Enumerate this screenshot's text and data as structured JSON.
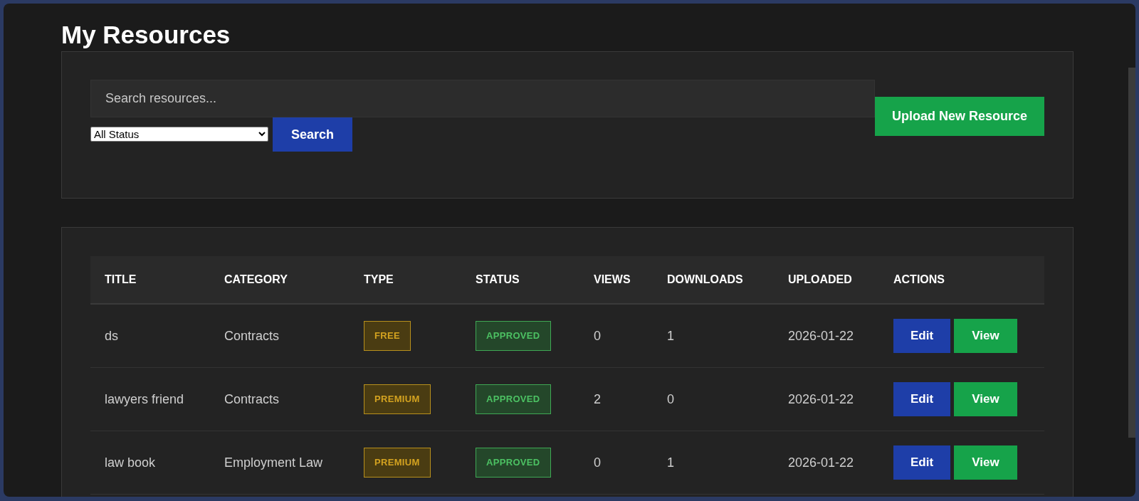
{
  "page": {
    "title": "My Resources"
  },
  "search": {
    "placeholder": "Search resources...",
    "status_filter": "All Status",
    "search_button": "Search",
    "upload_button": "Upload New Resource"
  },
  "table": {
    "columns": [
      "TITLE",
      "CATEGORY",
      "TYPE",
      "STATUS",
      "VIEWS",
      "DOWNLOADS",
      "UPLOADED",
      "ACTIONS"
    ],
    "rows": [
      {
        "title": "ds",
        "category": "Contracts",
        "type": "FREE",
        "status": {
          "label": "APPROVED",
          "kind": "approved"
        },
        "views": "0",
        "downloads": "1",
        "uploaded": "2026-01-22",
        "actions": [
          "Edit",
          "View"
        ]
      },
      {
        "title": "lawyers friend",
        "category": "Contracts",
        "type": "PREMIUM",
        "status": {
          "label": "APPROVED",
          "kind": "approved"
        },
        "views": "2",
        "downloads": "0",
        "uploaded": "2026-01-22",
        "actions": [
          "Edit",
          "View"
        ]
      },
      {
        "title": "law book",
        "category": "Employment Law",
        "type": "PREMIUM",
        "status": {
          "label": "APPROVED",
          "kind": "approved"
        },
        "views": "0",
        "downloads": "1",
        "uploaded": "2026-01-22",
        "actions": [
          "Edit",
          "View"
        ]
      }
    ]
  }
}
